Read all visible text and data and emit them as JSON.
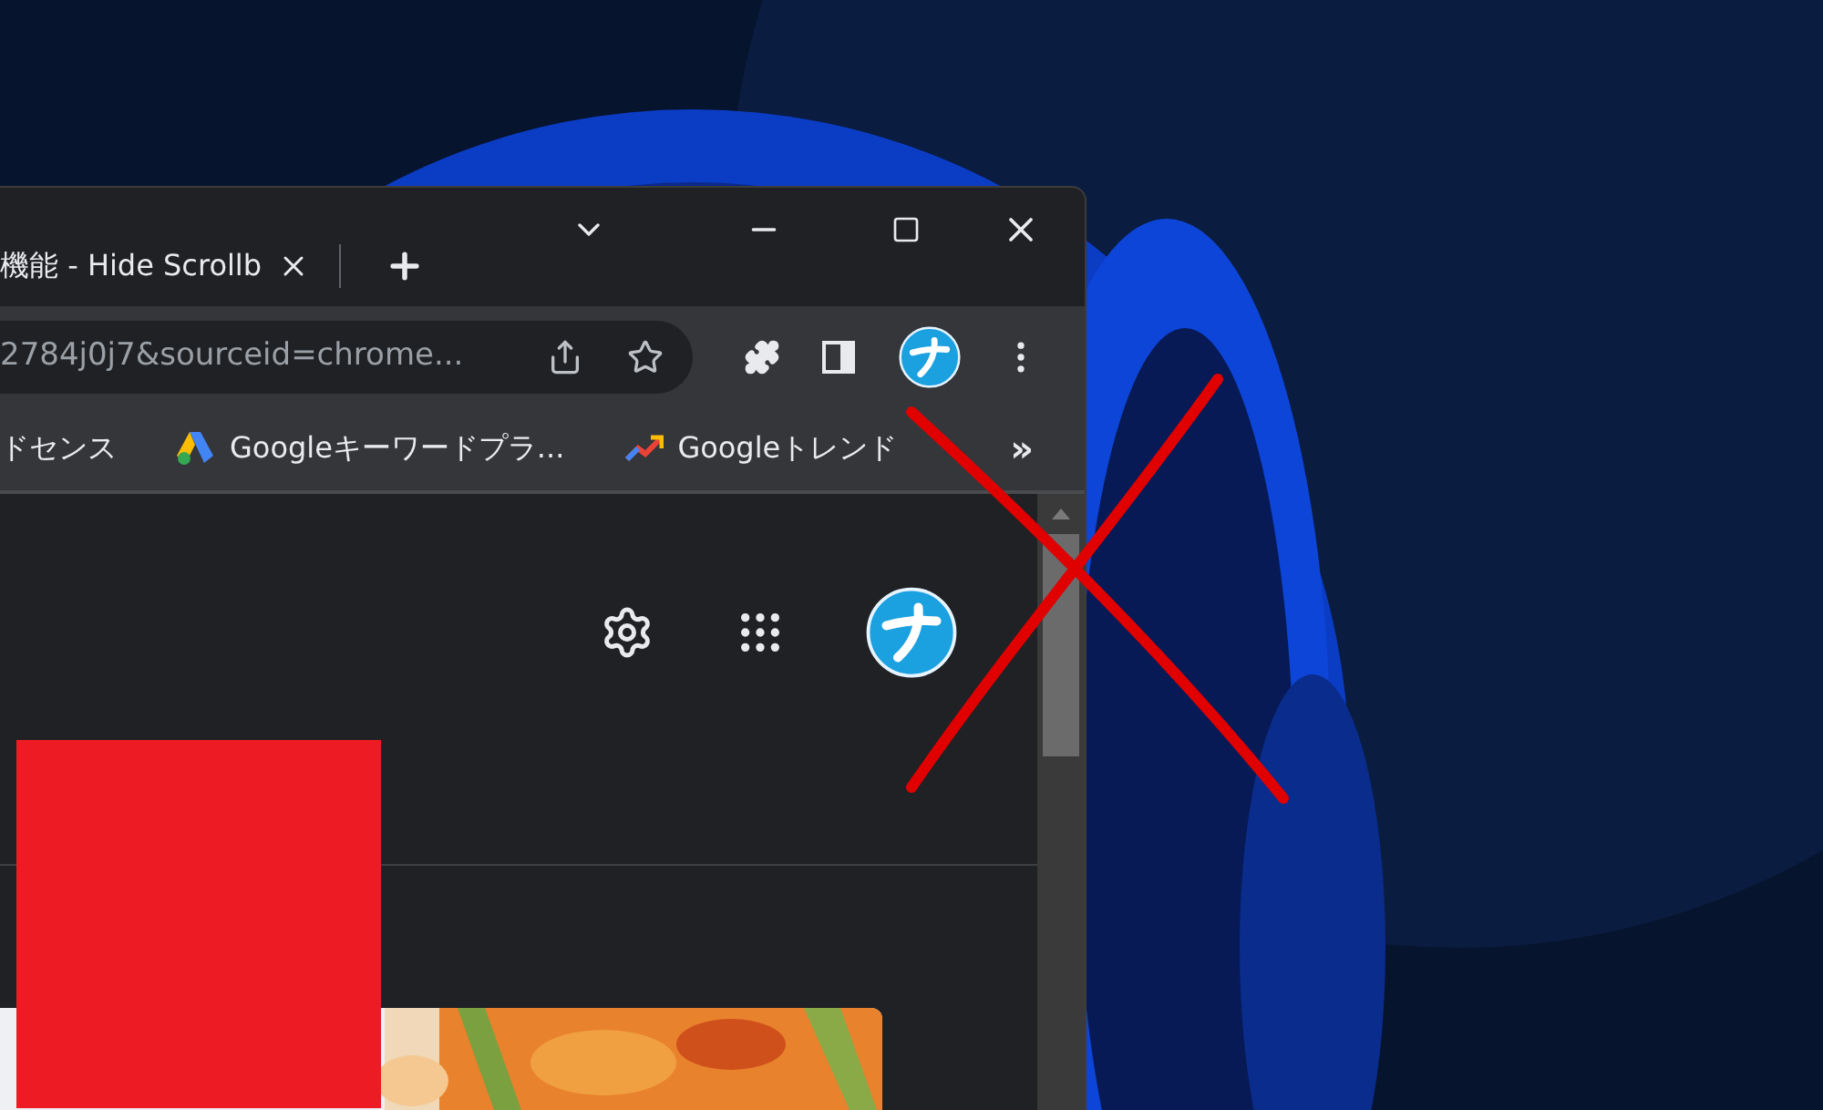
{
  "tab": {
    "title": "機能 - Hide Scrollb"
  },
  "address_bar": {
    "url": "2784j0j7&sourceid=chrome..."
  },
  "bookmarks": [
    {
      "kind": "plain",
      "label": "ドセンス"
    },
    {
      "kind": "ads",
      "label": "Googleキーワードプラ..."
    },
    {
      "kind": "trends",
      "label": "Googleトレンド"
    }
  ],
  "bookmarks_overflow": "»"
}
